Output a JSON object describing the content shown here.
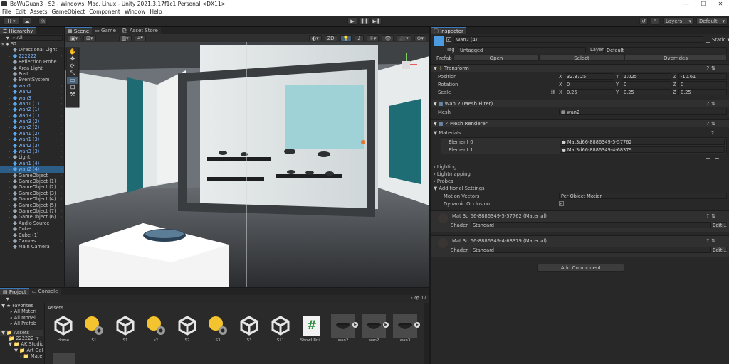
{
  "window": {
    "title": "BoWuGuan3 - S2 - Windows, Mac, Linux - Unity 2021.3.17f1c1 Personal <DX11>",
    "controls": [
      "—",
      "☐",
      "✕"
    ]
  },
  "menu": [
    "File",
    "Edit",
    "Assets",
    "GameObject",
    "Component",
    "Window",
    "Help"
  ],
  "toolbar": {
    "account": "H ▾",
    "play": "▶",
    "pause": "❚❚",
    "step": "▶❚",
    "layers": "Layers",
    "layout": "Default"
  },
  "hierarchy": {
    "tab": "Hierarchy",
    "search": "All",
    "scene": "S2",
    "items": [
      {
        "label": "Directional Light",
        "indent": 1,
        "blue": false
      },
      {
        "label": "222222",
        "indent": 1,
        "blue": true,
        "arrow": true
      },
      {
        "label": "Reflection Probe",
        "indent": 1,
        "blue": false
      },
      {
        "label": "Area Light",
        "indent": 1,
        "blue": false
      },
      {
        "label": "Post",
        "indent": 1,
        "blue": false
      },
      {
        "label": "EventSystem",
        "indent": 1,
        "blue": false
      },
      {
        "label": "wan1",
        "indent": 1,
        "blue": true,
        "arrow": true
      },
      {
        "label": "wan2",
        "indent": 1,
        "blue": true,
        "arrow": true
      },
      {
        "label": "wan3",
        "indent": 1,
        "blue": true,
        "arrow": true
      },
      {
        "label": "wan1 (1)",
        "indent": 1,
        "blue": true,
        "arrow": true
      },
      {
        "label": "wan2 (1)",
        "indent": 1,
        "blue": true,
        "arrow": true
      },
      {
        "label": "wan3 (1)",
        "indent": 1,
        "blue": true,
        "arrow": true
      },
      {
        "label": "wan3 (2)",
        "indent": 1,
        "blue": true,
        "arrow": true
      },
      {
        "label": "wan2 (2)",
        "indent": 1,
        "blue": true,
        "arrow": true
      },
      {
        "label": "wan1 (2)",
        "indent": 1,
        "blue": true,
        "arrow": true
      },
      {
        "label": "wan1 (3)",
        "indent": 1,
        "blue": true,
        "arrow": true
      },
      {
        "label": "wan2 (3)",
        "indent": 1,
        "blue": true,
        "arrow": true
      },
      {
        "label": "wan3 (3)",
        "indent": 1,
        "blue": true,
        "arrow": true
      },
      {
        "label": "Light",
        "indent": 1,
        "blue": false,
        "arrow": true
      },
      {
        "label": "wan1 (4)",
        "indent": 1,
        "blue": true,
        "arrow": true
      },
      {
        "label": "wan2 (4)",
        "indent": 1,
        "blue": true,
        "arrow": true,
        "selected": true
      },
      {
        "label": "GameObject",
        "indent": 1,
        "blue": false,
        "arrow": true
      },
      {
        "label": "GameObject (1)",
        "indent": 1,
        "blue": false,
        "arrow": true
      },
      {
        "label": "GameObject (2)",
        "indent": 1,
        "blue": false,
        "arrow": true
      },
      {
        "label": "GameObject (3)",
        "indent": 1,
        "blue": false,
        "arrow": true
      },
      {
        "label": "GameObject (4)",
        "indent": 1,
        "blue": false,
        "arrow": true
      },
      {
        "label": "GameObject (5)",
        "indent": 1,
        "blue": false,
        "arrow": true
      },
      {
        "label": "GameObject (7)",
        "indent": 1,
        "blue": false,
        "arrow": true
      },
      {
        "label": "GameObject (6)",
        "indent": 1,
        "blue": false,
        "arrow": true
      },
      {
        "label": "Audio Source",
        "indent": 1,
        "blue": false
      },
      {
        "label": "Cube",
        "indent": 1,
        "blue": false
      },
      {
        "label": "Cube (1)",
        "indent": 1,
        "blue": false
      },
      {
        "label": "Canvas",
        "indent": 1,
        "blue": false,
        "arrow": true
      },
      {
        "label": "Main Camera",
        "indent": 1,
        "blue": false
      }
    ]
  },
  "scene": {
    "tabs": [
      "Scene",
      "Game",
      "Asset Store"
    ],
    "mode2d": "2D"
  },
  "inspector": {
    "tab": "Inspector",
    "object_name": "wan2 (4)",
    "static": "Static",
    "tag_label": "Tag",
    "tag": "Untagged",
    "layer_label": "Layer",
    "layer": "Default",
    "prefab_label": "Prefab",
    "prefab_buttons": [
      "Open",
      "Select",
      "Overrides"
    ],
    "transform": {
      "title": "Transform",
      "rows": [
        {
          "label": "Position",
          "x": "32.3725",
          "y": "1.025",
          "z": "-10.61"
        },
        {
          "label": "Rotation",
          "x": "0",
          "y": "0",
          "z": "0"
        },
        {
          "label": "Scale",
          "x": "0.25",
          "y": "0.25",
          "z": "0.25"
        }
      ]
    },
    "mesh_filter": {
      "title": "Wan 2 (Mesh Filter)",
      "mesh_label": "Mesh",
      "mesh": "wan2"
    },
    "mesh_renderer": {
      "title": "Mesh Renderer",
      "materials_label": "Materials",
      "materials_count": "2",
      "elements": [
        {
          "label": "Element 0",
          "value": "Mat3d66-8886349-5-57762"
        },
        {
          "label": "Element 1",
          "value": "Mat3d66-8886349-4-68379"
        }
      ],
      "sections": [
        "Lighting",
        "Lightmapping",
        "Probes",
        "Additional Settings"
      ],
      "motion_vectors_label": "Motion Vectors",
      "motion_vectors": "Per Object Motion",
      "dynamic_occlusion_label": "Dynamic Occlusion"
    },
    "materials": [
      {
        "name": "Mat 3d 66-8886349-5-57762 (Material)",
        "shader_label": "Shader",
        "shader": "Standard",
        "edit": "Edit..."
      },
      {
        "name": "Mat 3d 66-8886349-4-68379 (Material)",
        "shader_label": "Shader",
        "shader": "Standard",
        "edit": "Edit..."
      }
    ],
    "add_component": "Add Component"
  },
  "project": {
    "tabs": [
      "Project",
      "Console"
    ],
    "favorites_label": "Favorites",
    "favorites": [
      "All Materi",
      "All Model",
      "All Prefab"
    ],
    "assets_label": "Assets",
    "tree": [
      "222222 fr",
      "AK Studio",
      "Art Gal",
      "Mate"
    ],
    "breadcrumb": "Assets",
    "count": "17",
    "assets": [
      {
        "label": "Home",
        "kind": "unity"
      },
      {
        "label": "S1",
        "kind": "light"
      },
      {
        "label": "S1",
        "kind": "unity"
      },
      {
        "label": "s2",
        "kind": "light"
      },
      {
        "label": "S2",
        "kind": "unity"
      },
      {
        "label": "S3",
        "kind": "light"
      },
      {
        "label": "S3",
        "kind": "unity"
      },
      {
        "label": "S11",
        "kind": "unity"
      },
      {
        "label": "ShowUIIni...",
        "kind": "script"
      },
      {
        "label": "wan2",
        "kind": "bowl"
      },
      {
        "label": "wan2",
        "kind": "bowl"
      },
      {
        "label": "wan3",
        "kind": "bowl"
      }
    ]
  }
}
